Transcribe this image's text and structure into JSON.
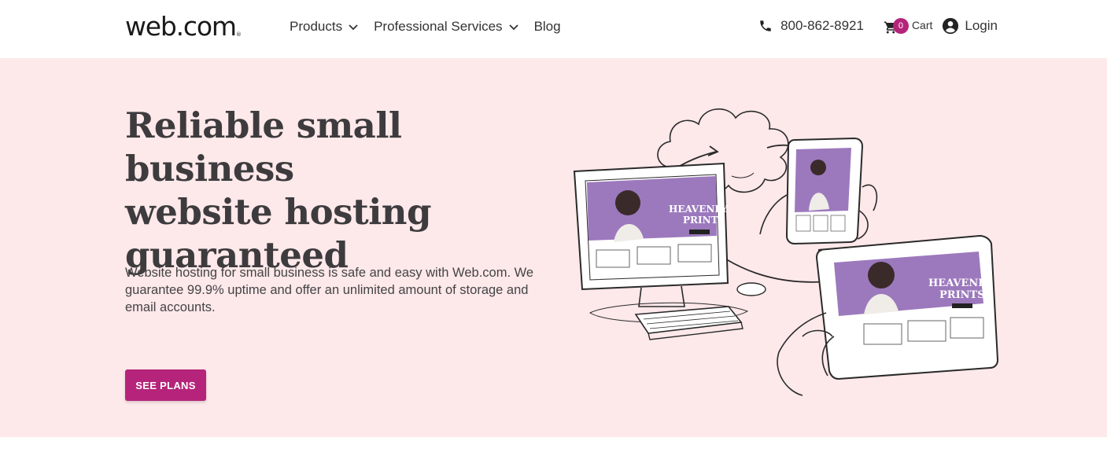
{
  "header": {
    "logo_text": "web.com",
    "logo_mark": "®",
    "nav": [
      {
        "label": "Products",
        "has_dropdown": true
      },
      {
        "label": "Professional Services",
        "has_dropdown": true
      },
      {
        "label": "Blog",
        "has_dropdown": false
      }
    ],
    "phone": "800-862-8921",
    "cart": {
      "count": "0",
      "label": "Cart"
    },
    "login_label": "Login"
  },
  "hero": {
    "title_lines": [
      "Reliable small business",
      "website hosting",
      "guaranteed"
    ],
    "description": "Website hosting for small business is safe and easy with Web.com. We guarantee 99.9% uptime and offer an unlimited amount of storage and email accounts.",
    "cta_label": "SEE PLANS",
    "illustration": {
      "screen_title_1": "HEAVENLY",
      "screen_title_2": "PRINTS"
    }
  },
  "colors": {
    "accent": "#b5247a",
    "hero_bg": "#fde8ea",
    "heading": "#3d3b3d",
    "screen_purple": "#9c79bd"
  },
  "icons": [
    "phone-icon",
    "cart-icon",
    "user-circle-icon",
    "chevron-down-icon"
  ]
}
